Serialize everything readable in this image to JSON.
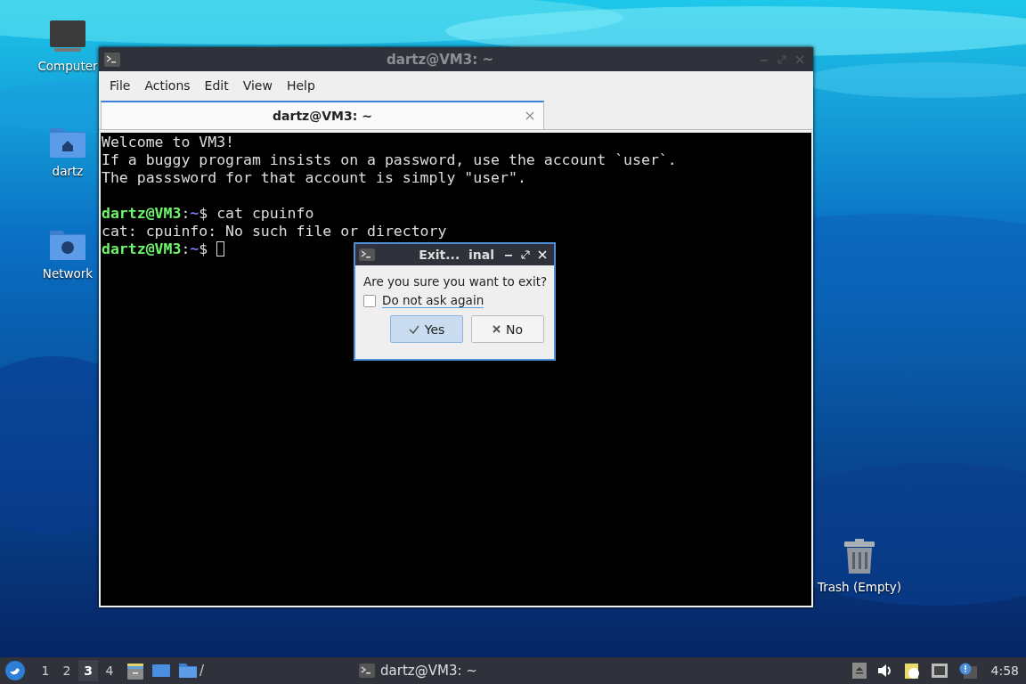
{
  "desktop_icons": [
    {
      "label": "Computer",
      "kind": "computer"
    },
    {
      "label": "dartz",
      "kind": "home"
    },
    {
      "label": "Network",
      "kind": "network"
    },
    {
      "label": "Trash (Empty)",
      "kind": "trash"
    }
  ],
  "terminal_window": {
    "title": "dartz@VM3: ~",
    "menu": [
      "File",
      "Actions",
      "Edit",
      "View",
      "Help"
    ],
    "tabs": [
      {
        "label": "dartz@VM3: ~",
        "selected": true
      }
    ],
    "lines": [
      {
        "kind": "text",
        "segments": [
          {
            "kind": "text",
            "text": "Welcome to VM3!"
          }
        ]
      },
      {
        "kind": "text",
        "segments": [
          {
            "kind": "text",
            "text": "If a buggy program insists on a password, use the account `user`."
          }
        ]
      },
      {
        "kind": "text",
        "segments": [
          {
            "kind": "text",
            "text": "The passsword for that account is simply \"user\"."
          }
        ]
      },
      {
        "kind": "blank"
      },
      {
        "kind": "text",
        "segments": [
          {
            "kind": "user",
            "text": "dartz@VM3"
          },
          {
            "kind": "text",
            "text": ":"
          },
          {
            "kind": "path",
            "text": "~"
          },
          {
            "kind": "text",
            "text": "$ cat cpuinfo"
          }
        ]
      },
      {
        "kind": "text",
        "segments": [
          {
            "kind": "text",
            "text": "cat: cpuinfo: No such file or directory"
          }
        ]
      },
      {
        "kind": "text",
        "segments": [
          {
            "kind": "user",
            "text": "dartz@VM3"
          },
          {
            "kind": "text",
            "text": ":"
          },
          {
            "kind": "path",
            "text": "~"
          },
          {
            "kind": "text",
            "text": "$ "
          }
        ]
      }
    ],
    "cursor": true
  },
  "dialog": {
    "title": "Exit...  inal",
    "message": "Are you sure you want to exit?",
    "checkbox": {
      "label": "Do not ask again",
      "checked": false
    },
    "buttons": [
      {
        "label": "Yes",
        "kind": "yes",
        "default": true
      },
      {
        "label": "No",
        "kind": "no",
        "default": false
      }
    ]
  },
  "taskbar": {
    "workspaces": [
      {
        "label": "1",
        "selected": false
      },
      {
        "label": "2",
        "selected": false
      },
      {
        "label": "3",
        "selected": true
      },
      {
        "label": "4",
        "selected": false
      }
    ],
    "path_label": "/",
    "task": "dartz@VM3: ~",
    "clock": "4:58"
  }
}
